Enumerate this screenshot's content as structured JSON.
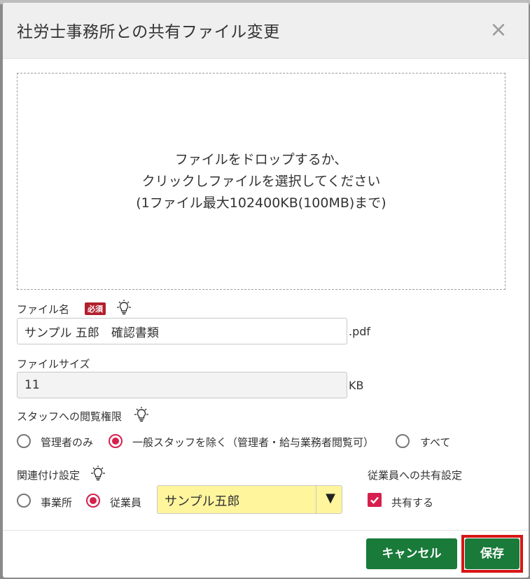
{
  "dialog": {
    "title": "社労士事務所との共有ファイル変更",
    "close_label": "×"
  },
  "dropzone": {
    "line1": "ファイルをドロップするか、",
    "line2": "クリックしファイルを選択してください",
    "line3": "(1ファイル最大102400KB(100MB)まで)"
  },
  "file_name": {
    "label": "ファイル名",
    "required_badge": "必須",
    "value": "サンプル 五郎　確認書類",
    "suffix": ".pdf"
  },
  "file_size": {
    "label": "ファイルサイズ",
    "value": "11",
    "suffix": "KB"
  },
  "staff_permission": {
    "label": "スタッフへの閲覧権限",
    "options": [
      {
        "label": "管理者のみ",
        "checked": false
      },
      {
        "label": "一般スタッフを除く（管理者・給与業務者閲覧可）",
        "checked": true
      },
      {
        "label": "すべて",
        "checked": false
      }
    ]
  },
  "association": {
    "label": "関連付け設定",
    "options": [
      {
        "label": "事業所",
        "checked": false
      },
      {
        "label": "従業員",
        "checked": true
      }
    ],
    "employee_select": "サンプル五郎",
    "select_arrow": "▼"
  },
  "employee_share": {
    "label": "従業員への共有設定",
    "checkbox_label": "共有する",
    "checked": true
  },
  "footer": {
    "cancel_label": "キャンセル",
    "save_label": "保存"
  },
  "colors": {
    "accent_green": "#1a7a3a",
    "radio_red": "#d6204e",
    "required_red": "#b21f2d",
    "select_yellow": "#fff59d",
    "highlight_red": "#d61515"
  }
}
